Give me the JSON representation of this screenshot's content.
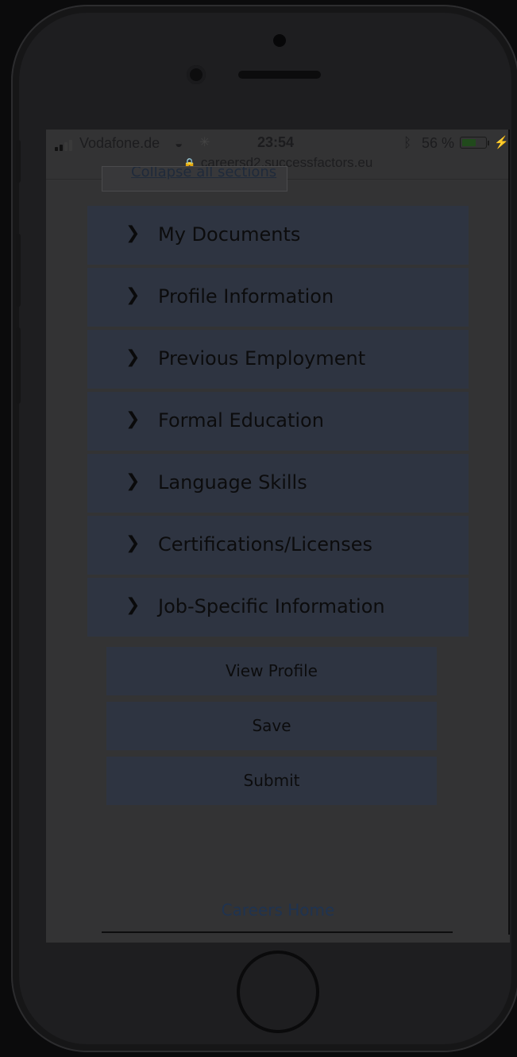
{
  "status_bar": {
    "carrier": "Vodafone.de",
    "time": "23:54",
    "battery_percent": "56 %",
    "battery_level": 0.56
  },
  "url_bar": {
    "url": "careersd2.successfactors.eu"
  },
  "collapse_button": {
    "label": "Collapse all sections"
  },
  "sections": [
    {
      "label": "My Documents"
    },
    {
      "label": "Profile Information"
    },
    {
      "label": "Previous Employment"
    },
    {
      "label": "Formal Education"
    },
    {
      "label": "Language Skills"
    },
    {
      "label": "Certifications/Licenses"
    },
    {
      "label": "Job-Specific Information"
    }
  ],
  "actions": {
    "view_profile": "View Profile",
    "save": "Save",
    "submit": "Submit"
  },
  "footer": {
    "careers_home": "Careers Home"
  },
  "colors": {
    "section_bg": "#2e3441",
    "link": "#1f3350",
    "battery": "#214a1c"
  }
}
